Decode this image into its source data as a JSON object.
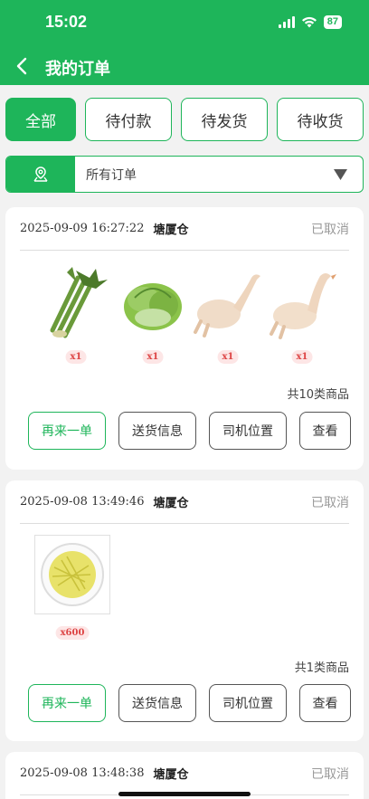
{
  "status_bar": {
    "time": "15:02",
    "battery": "87"
  },
  "nav": {
    "title": "我的订单"
  },
  "tabs": [
    {
      "label": "全部"
    },
    {
      "label": "待付款"
    },
    {
      "label": "待发货"
    },
    {
      "label": "待收货"
    }
  ],
  "filter": {
    "selected": "所有订单"
  },
  "orders": [
    {
      "date": "2025-09-09 16:27:22",
      "store": "塘厦仓",
      "status": "已取消",
      "items": [
        {
          "qty": "x1",
          "icon": "asparagus-lettuce-image"
        },
        {
          "qty": "x1",
          "icon": "lettuce-image"
        },
        {
          "qty": "x1",
          "icon": "whole-duck-image"
        },
        {
          "qty": "x1",
          "icon": "whole-goose-image"
        }
      ],
      "count_text": "共10类商品",
      "buttons": {
        "reorder": "再来一单",
        "delivery": "送货信息",
        "driver": "司机位置",
        "view": "查看"
      }
    },
    {
      "date": "2025-09-08 13:49:46",
      "store": "塘厦仓",
      "status": "已取消",
      "items": [
        {
          "qty": "x600",
          "icon": "shredded-potato-image"
        }
      ],
      "count_text": "共1类商品",
      "buttons": {
        "reorder": "再来一单",
        "delivery": "送货信息",
        "driver": "司机位置",
        "view": "查看"
      }
    },
    {
      "date": "2025-09-08 13:48:38",
      "store": "塘厦仓",
      "status": "已取消"
    }
  ],
  "colors": {
    "brand_green": "#1eb55a",
    "cancelled_gray": "#999999",
    "qty_badge_bg": "#fde6e6"
  }
}
